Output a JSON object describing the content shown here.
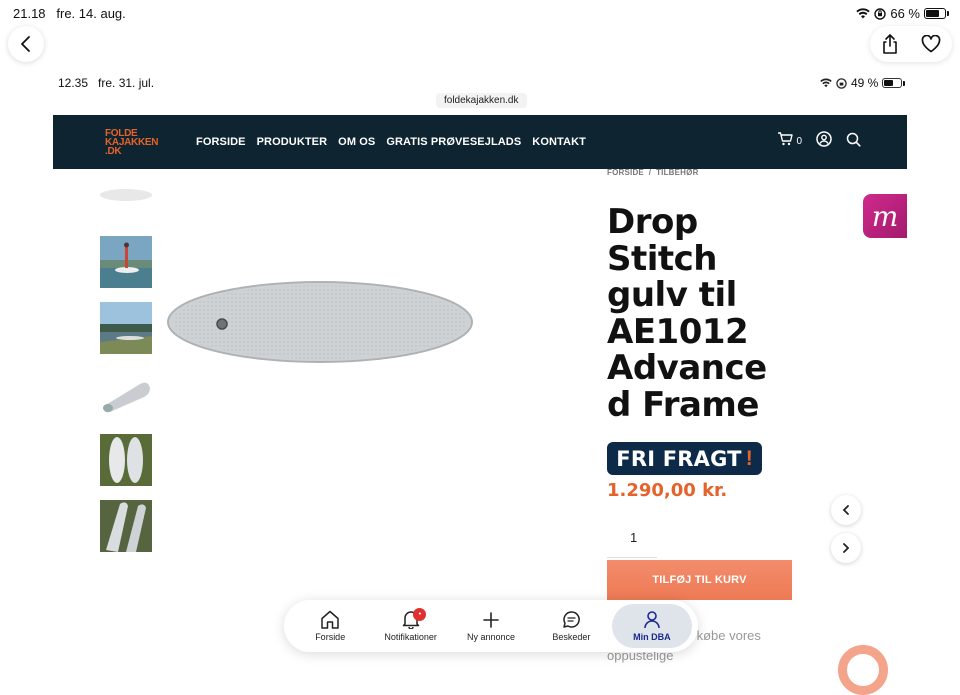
{
  "outer_status": {
    "time": "21.18",
    "date": "fre. 14. aug.",
    "battery": "66 %",
    "battery_level": 0.66
  },
  "inner_status": {
    "time_date": "12.35   fre. 31. jul.",
    "battery": "49 %",
    "battery_level": 0.49
  },
  "browser": {
    "url": "foldekajakken.dk",
    "back_icon": "chevron-left-icon",
    "share_icon": "share-icon",
    "favorite_icon": "heart-icon"
  },
  "site": {
    "logo": {
      "line1": "FOLDE",
      "line2": "KAJAKKEN",
      "line3": ".DK"
    },
    "nav": [
      "FORSIDE",
      "PRODUKTER",
      "OM OS",
      "GRATIS PRØVESEJLADS",
      "KONTAKT"
    ],
    "cart_count": "0"
  },
  "product": {
    "breadcrumb": "FORSIDE  /  TILBEHØR",
    "title": "Drop Stitch gulv til AE1012 Advance d Frame",
    "shipping_badge": "FRI FRAGT",
    "shipping_badge_mark": "!",
    "price": "1.290,00 kr.",
    "quantity": "1",
    "add_to_cart": "TILFØJ TIL KURV",
    "promo_text": "overvejer du at købe vores oppustelige"
  },
  "colors": {
    "header_bg": "#0e2430",
    "accent": "#e5632b",
    "badge_bg": "#0d2b49",
    "button": "#ee7a55",
    "tab_active": "#1b2a8e"
  },
  "tabbar": {
    "tabs": [
      {
        "label": "Forside",
        "icon": "home-icon"
      },
      {
        "label": "Notifikationer",
        "icon": "bell-icon",
        "badge": "•"
      },
      {
        "label": "Ny annonce",
        "icon": "plus-icon"
      },
      {
        "label": "Beskeder",
        "icon": "chat-icon"
      },
      {
        "label": "Min DBA",
        "icon": "user-icon",
        "active": true
      }
    ]
  }
}
